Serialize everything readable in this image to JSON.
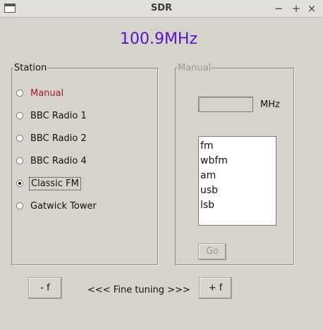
{
  "window": {
    "title": "SDR",
    "controls": {
      "minimize": "−",
      "maximize": "+",
      "close": "×"
    }
  },
  "frequency_display": "100.9MHz",
  "station_group": {
    "legend": "Station",
    "options": [
      {
        "label": "Manual",
        "selected": false
      },
      {
        "label": "BBC Radio 1",
        "selected": false
      },
      {
        "label": "BBC Radio 2",
        "selected": false
      },
      {
        "label": "BBC Radio 4",
        "selected": false
      },
      {
        "label": "Classic FM",
        "selected": true
      },
      {
        "label": "Gatwick Tower",
        "selected": false
      }
    ]
  },
  "manual_group": {
    "legend": "Manual",
    "frequency_value": "",
    "unit_label": "MHz",
    "modes": [
      "fm",
      "wbfm",
      "am",
      "usb",
      "lsb"
    ],
    "go_label": "Go"
  },
  "fine_tuning": {
    "minus_label": "- f",
    "label": "<<< Fine tuning >>>",
    "plus_label": "+ f"
  },
  "colors": {
    "frequency_text": "#5a13c7",
    "manual_option_text": "#a51d2d",
    "disabled_text": "#9a9893",
    "background": "#d6d3cc"
  }
}
